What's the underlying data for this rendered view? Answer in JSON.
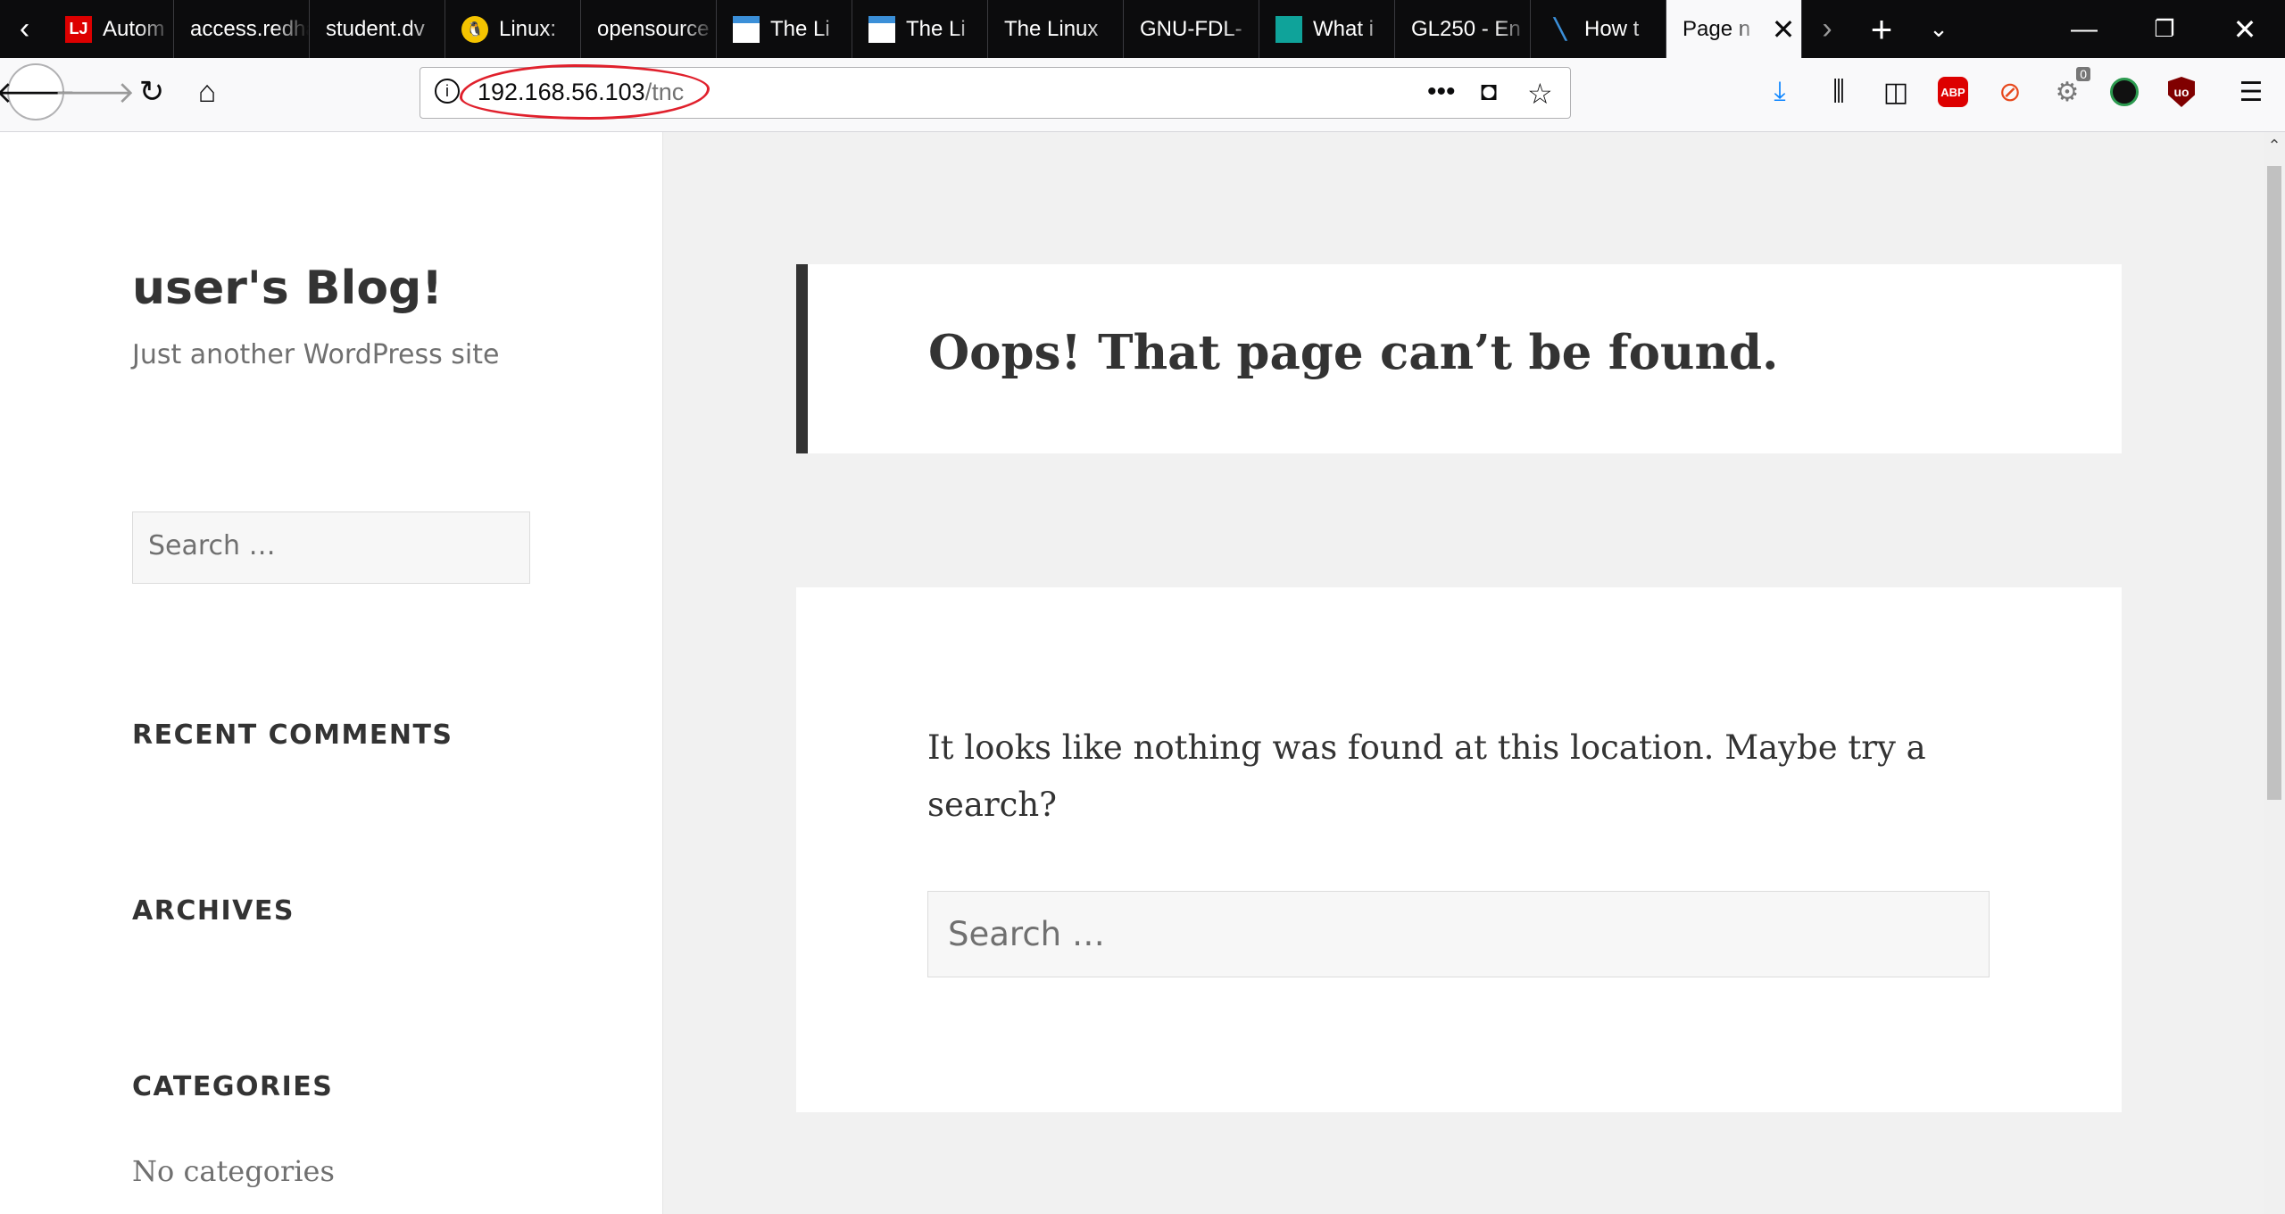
{
  "tabs": [
    {
      "label": "Autom",
      "favicon": "LJ"
    },
    {
      "label": "access.redhat",
      "favicon": ""
    },
    {
      "label": "student.dv",
      "favicon": ""
    },
    {
      "label": "Linux:",
      "favicon": ""
    },
    {
      "label": "opensource",
      "favicon": ""
    },
    {
      "label": "The Li",
      "favicon": ""
    },
    {
      "label": "The Li",
      "favicon": ""
    },
    {
      "label": "The Linux",
      "favicon": ""
    },
    {
      "label": "GNU-FDL-",
      "favicon": ""
    },
    {
      "label": "What i",
      "favicon": ""
    },
    {
      "label": "GL250 - En",
      "favicon": ""
    },
    {
      "label": "How t",
      "favicon": ""
    },
    {
      "label": "Page n",
      "favicon": ""
    }
  ],
  "toolbar": {
    "url_host": "192.168.56.103",
    "url_path": "/tnc",
    "extension_badge": "0",
    "abp_label": "ABP",
    "ublock_label": "uo"
  },
  "sidebar": {
    "site_title": "user's Blog!",
    "site_description": "Just another WordPress site",
    "search_placeholder": "Search …",
    "widgets": [
      "RECENT COMMENTS",
      "ARCHIVES",
      "CATEGORIES"
    ],
    "categories_empty": "No categories"
  },
  "main": {
    "error_title": "Oops! That page can’t be found.",
    "message": "It looks like nothing was found at this location. Maybe try a search?",
    "search_placeholder": "Search …"
  }
}
